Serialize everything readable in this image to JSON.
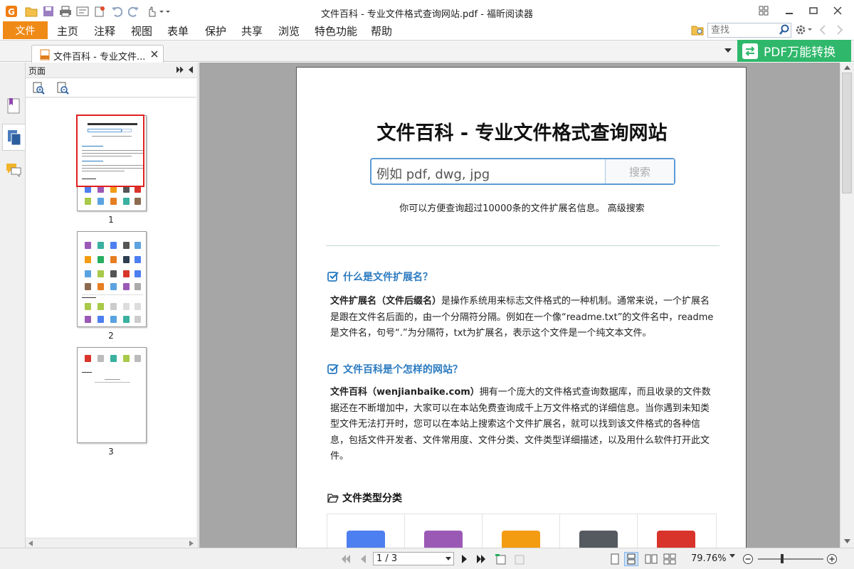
{
  "window": {
    "title": "文件百科 - 专业文件格式查询网站.pdf - 福昕阅读器"
  },
  "menu": {
    "file": "文件",
    "items": [
      "主页",
      "注释",
      "视图",
      "表单",
      "保护",
      "共享",
      "浏览",
      "特色功能",
      "帮助"
    ]
  },
  "search": {
    "placeholder": "查找"
  },
  "tab": {
    "label": "文件百科 - 专业文件..."
  },
  "convert": {
    "label": "PDF万能转换"
  },
  "panel": {
    "title": "页面",
    "page_numbers": [
      "1",
      "2",
      "3"
    ]
  },
  "doc": {
    "title": "文件百科 - 专业文件格式查询网站",
    "search_placeholder": "例如 pdf, dwg, jpg",
    "search_button": "搜索",
    "subtitle": "你可以方便查询超过10000条的文件扩展名信息。 高级搜索",
    "section1": {
      "heading": "什么是文件扩展名？",
      "term": "文件扩展名（文件后缀名）",
      "text": "是操作系统用来标志文件格式的一种机制。通常来说，一个扩展名是跟在文件名后面的，由一个分隔符分隔。例如在一个像“readme.txt”的文件名中，readme是文件名，句号“.”为分隔符，txt为扩展名，表示这个文件是一个纯文本文件。"
    },
    "section2": {
      "heading": "文件百科是个怎样的网站？",
      "term": "文件百科（wenjianbaike.com）",
      "text": "拥有一个庞大的文件格式查询数据库，而且收录的文件数据还在不断增加中，大家可以在本站免费查询成千上万文件格式的详细信息。当你遇到未知类型文件无法打开时，您可以在本站上搜索这个文件扩展名，就可以找到该文件格式的各种信息，包括文件开发者、文件常用度、文件分类、文件类型详细描述，以及用什么软件打开此文件。"
    },
    "types_heading": "文件类型分类"
  },
  "status": {
    "page_field": "1 / 3",
    "zoom": "79.76%"
  },
  "colors": {
    "accent_orange": "#f08a17",
    "convert_green": "#2fb86b",
    "link_blue": "#2b7bc0"
  }
}
